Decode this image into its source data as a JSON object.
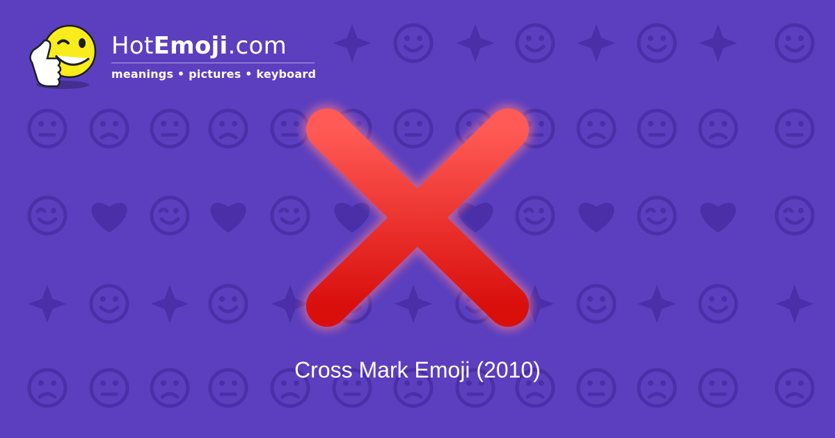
{
  "site": {
    "brand_prefix": "Hot",
    "brand_bold": "Emoji",
    "brand_suffix": ".com",
    "tagline": "meanings • pictures • keyboard",
    "mascot": "winking-thumbs-up-smiley-icon"
  },
  "emoji": {
    "icon": "cross-mark-icon",
    "caption": "Cross Mark Emoji (2010)",
    "color": "#e8201c"
  },
  "colors": {
    "background": "#5b3fbf",
    "pattern": "#4a2fa8",
    "text": "#ffffff"
  }
}
